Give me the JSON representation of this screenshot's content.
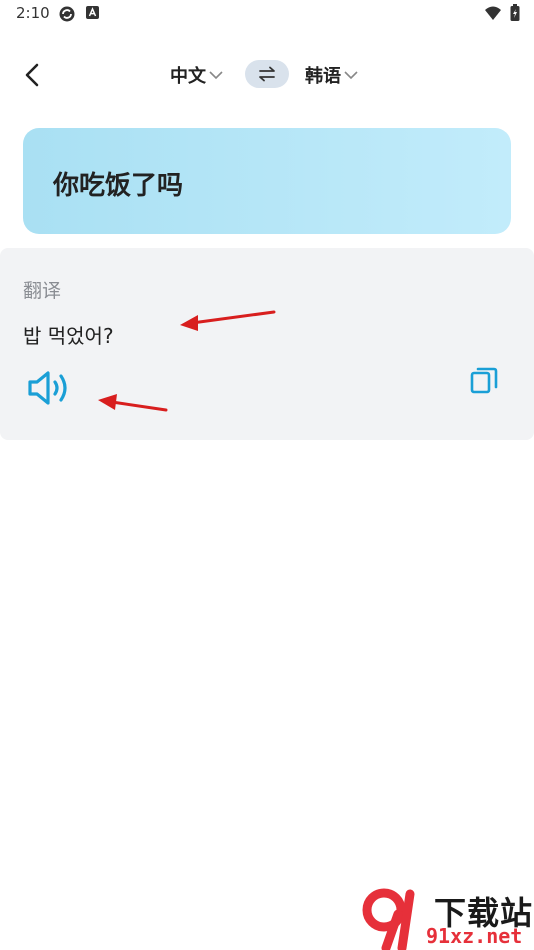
{
  "status_bar": {
    "time": "2:10"
  },
  "header": {
    "source_language": "中文",
    "target_language": "韩语"
  },
  "input": {
    "text": "你吃饭了吗"
  },
  "result": {
    "title": "翻译",
    "text": "밥 먹었어?"
  },
  "watermark": {
    "text_cn": "下载站",
    "text_en": "91xz.net"
  },
  "colors": {
    "accent": "#1a9fd6",
    "card_gradient_start": "#a9e0f3",
    "card_gradient_end": "#c2ecfb",
    "result_bg": "#f2f3f5",
    "arrow": "#d81e1e"
  }
}
